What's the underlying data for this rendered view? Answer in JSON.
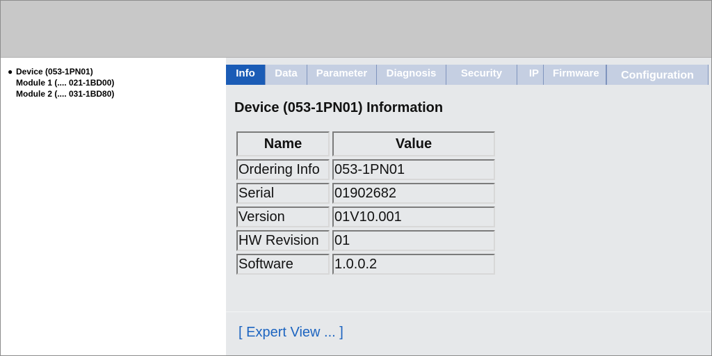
{
  "tree": {
    "bullet": "●",
    "device": "Device (053-1PN01)",
    "modules": [
      "Module 1 (.... 021-1BD00)",
      "Module 2 (.... 031-1BD80)"
    ]
  },
  "tabs": [
    {
      "label": "Info",
      "active": true
    },
    {
      "label": "Data",
      "active": false
    },
    {
      "label": "Parameter",
      "active": false
    },
    {
      "label": "Diagnosis",
      "active": false
    },
    {
      "label": "Security",
      "active": false
    },
    {
      "label": "IP",
      "active": false
    },
    {
      "label": "Firmware",
      "active": false
    },
    {
      "label": "Configuration",
      "active": false
    }
  ],
  "info": {
    "title": "Device (053-1PN01) Information",
    "headers": {
      "name": "Name",
      "value": "Value"
    },
    "rows": [
      {
        "name": "Ordering Info",
        "value": "053-1PN01"
      },
      {
        "name": "Serial",
        "value": "01902682"
      },
      {
        "name": "Version",
        "value": "01V10.001"
      },
      {
        "name": "HW Revision",
        "value": "01"
      },
      {
        "name": "Software",
        "value": "1.0.0.2"
      }
    ]
  },
  "expert_link": "[ Expert View ... ]",
  "colors": {
    "banner": "#c8c8c8",
    "tab_active": "#1b5cb6",
    "tab_inactive": "#c5cfe2",
    "content_bg": "#e6e8ea",
    "link": "#1c64c0"
  }
}
